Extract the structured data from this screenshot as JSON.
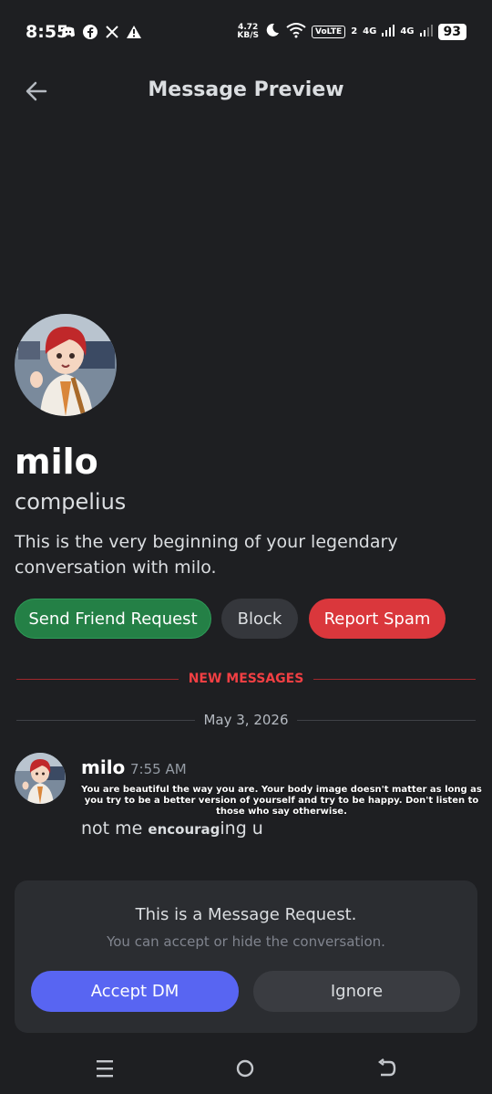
{
  "status_bar": {
    "time": "8:55",
    "net_speed": "4.72",
    "net_unit": "KB/S",
    "volte": "VoLTE",
    "sim2": "2",
    "sig1": "4G",
    "sig2": "4G",
    "battery": "93",
    "left_icons": [
      "discord-icon",
      "facebook-icon",
      "x-icon",
      "alert-icon"
    ]
  },
  "header": {
    "title": "Message Preview"
  },
  "profile": {
    "display_name": "milo",
    "username": "compelius",
    "intro": "This is the very beginning of your legendary conversation with milo."
  },
  "actions": {
    "friend": "Send Friend Request",
    "block": "Block",
    "spam": "Report Spam"
  },
  "dividers": {
    "new_messages": "NEW MESSAGES",
    "date": "May 3, 2026"
  },
  "message": {
    "author": "milo",
    "time": "7:55 AM",
    "overlay": "You are beautiful the way you are. Your body image doesn't matter as long as you try to be a better version of yourself and try to be happy. Don't listen to those who say otherwise.",
    "text_a": "not me ",
    "text_bold": "encourag",
    "text_b": "ing u"
  },
  "request": {
    "title": "This is a Message Request.",
    "subtitle": "You can accept or hide the conversation.",
    "accept": "Accept DM",
    "ignore": "Ignore"
  },
  "colors": {
    "background": "#1e1f22",
    "friend_green": "#248046",
    "spam_red": "#da373c",
    "new_messages_red": "#f23f43",
    "accent_blurple": "#5865f2"
  }
}
